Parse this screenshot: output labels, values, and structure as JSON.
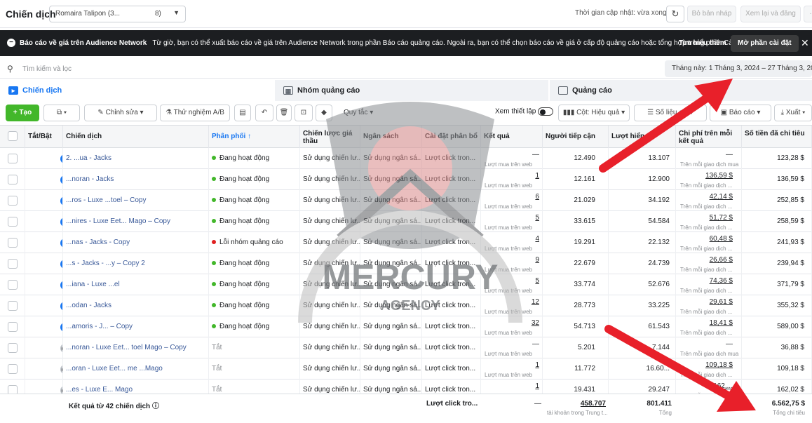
{
  "topbar": {
    "title": "Chiến dịch",
    "account_name": "Romaira Talipon (3...",
    "account_num": "8)",
    "update_text": "Thời gian cập nhật: vừa xong",
    "discard_label": "Bỏ bản nháp",
    "review_label": "Xem lại và đăng"
  },
  "banner": {
    "title": "Báo cáo về giá trên Audience Network",
    "text": "Từ giờ, bạn có thể xuất báo cáo về giá trên Audience Network trong phần Báo cáo quảng cáo. Ngoài ra, bạn có thể chọn báo cáo về giá ở cấp độ quảng cáo hoặc tổng hợp trong phần Cài...",
    "learn_more": "Tìm hiểu thêm",
    "open_settings": "Mở phần cài đặt"
  },
  "search": {
    "placeholder": "Tìm kiếm và lọc",
    "date_range": "Tháng này: 1 Tháng 3, 2024 – 27 Tháng 3, 2024"
  },
  "tabs": {
    "campaigns": "Chiến dịch",
    "adsets": "Nhóm quảng cáo",
    "ads": "Quảng cáo"
  },
  "toolbar": {
    "create": "+ Tạo",
    "edit": "Chỉnh sửa",
    "ab_test": "Thử nghiệm A/B",
    "rules": "Quy tắc",
    "view_setup": "Xem thiết lập",
    "columns": "Cột: Hiệu quả",
    "breakdown": "Số liệu chi",
    "reports": "Báo cáo",
    "export": "Xuất"
  },
  "columns": {
    "onoff": "Tắt/Bật",
    "campaign": "Chiến dịch",
    "delivery": "Phân phối ↑",
    "bid": "Chiến lược giá thầu",
    "budget": "Ngân sách",
    "attribution": "Cài đặt phân bổ",
    "results": "Kết quả",
    "reach": "Người tiếp cận",
    "impressions": "Lượt hiển",
    "cpr": "Chi phí trên mỗi kết quả",
    "spent": "Số tiền đã chi tiêu"
  },
  "rows": [
    {
      "on": true,
      "name": "2.  ...ua - Jacks",
      "status": "Đang hoạt động",
      "status_color": "#42b72a",
      "bid": "Sử dụng chiến lư...",
      "budget": "Sử dụng ngân sá...",
      "attr": "Lượt click tron...",
      "result": "—",
      "result_sub": "Lượt mua trên web",
      "reach": "12.490",
      "impr": "13.107",
      "cpr": "—",
      "cpr_sub": "Trên mỗi giao dịch mua",
      "spent": "123,28 $"
    },
    {
      "on": true,
      "name": "...noran - Jacks",
      "status": "Đang hoạt động",
      "status_color": "#42b72a",
      "bid": "Sử dụng chiến lư...",
      "budget": "Sử dụng ngân sá...",
      "attr": "Lượt click tron...",
      "result": "1",
      "result_sub": "Lượt mua trên web",
      "reach": "12.161",
      "impr": "12.900",
      "cpr": "136,59 $",
      "cpr_sub": "Trên mỗi giao dịch ...",
      "spent": "136,59 $"
    },
    {
      "on": true,
      "name": "...ros - Luxe ...toel – Copy",
      "status": "Đang hoạt động",
      "status_color": "#42b72a",
      "bid": "Sử dụng chiến lư...",
      "budget": "Sử dụng ngân sá...",
      "attr": "Lượt click tron...",
      "result": "6",
      "result_sub": "Lượt mua trên web",
      "reach": "21.029",
      "impr": "34.192",
      "cpr": "42,14 $",
      "cpr_sub": "Trên mỗi giao dịch ...",
      "spent": "252,85 $"
    },
    {
      "on": true,
      "name": "...nires - Luxe Eet... Mago – Copy",
      "status": "Đang hoạt động",
      "status_color": "#42b72a",
      "bid": "Sử dụng chiến lư...",
      "budget": "Sử dụng ngân sá...",
      "attr": "Lượt click tron...",
      "result": "5",
      "result_sub": "Lượt mua trên web",
      "reach": "33.615",
      "impr": "54.584",
      "cpr": "51,72 $",
      "cpr_sub": "Trên mỗi giao dịch ...",
      "spent": "258,59 $"
    },
    {
      "on": true,
      "name": "...nas - Jacks - Copy",
      "status": "Lỗi nhóm quảng cáo",
      "status_color": "#e02020",
      "bid": "Sử dụng chiến lư...",
      "budget": "Sử dụng ngân sá...",
      "attr": "Lượt click tron...",
      "result": "4",
      "result_sub": "Lượt mua trên web",
      "reach": "19.291",
      "impr": "22.132",
      "cpr": "60,48 $",
      "cpr_sub": "Trên mỗi giao dịch ...",
      "spent": "241,93 $"
    },
    {
      "on": true,
      "name": "...s - Jacks - ...y – Copy 2",
      "status": "Đang hoạt động",
      "status_color": "#42b72a",
      "bid": "Sử dụng chiến lư...",
      "budget": "Sử dụng ngân sá...",
      "attr": "Lượt click tron...",
      "result": "9",
      "result_sub": "Lượt mua trên web",
      "reach": "22.679",
      "impr": "24.739",
      "cpr": "26,66 $",
      "cpr_sub": "Trên mỗi giao dịch ...",
      "spent": "239,94 $"
    },
    {
      "on": true,
      "name": "...iana - Luxe ...el",
      "status": "Đang hoạt động",
      "status_color": "#42b72a",
      "bid": "Sử dụng chiến lư...",
      "budget": "Sử dụng ngân sá...",
      "attr": "Lượt click tron...",
      "result": "5",
      "result_sub": "Lượt mua trên web",
      "reach": "33.774",
      "impr": "52.676",
      "cpr": "74,36 $",
      "cpr_sub": "Trên mỗi giao dịch ...",
      "spent": "371,79 $"
    },
    {
      "on": true,
      "name": "...odan - Jacks",
      "status": "Đang hoạt động",
      "status_color": "#42b72a",
      "bid": "Sử dụng chiến lư...",
      "budget": "Sử dụng ngân sá...",
      "attr": "Lượt click tron...",
      "result": "12",
      "result_sub": "Lượt mua trên web",
      "reach": "28.773",
      "impr": "33.225",
      "cpr": "29,61 $",
      "cpr_sub": "Trên mỗi giao dịch ...",
      "spent": "355,32 $"
    },
    {
      "on": true,
      "name": "...amoris - J... – Copy",
      "status": "Đang hoạt động",
      "status_color": "#42b72a",
      "bid": "Sử dụng chiến lư...",
      "budget": "Sử dụng ngân sá...",
      "attr": "Lượt click tron...",
      "result": "32",
      "result_sub": "Lượt mua trên web",
      "reach": "54.713",
      "impr": "61.543",
      "cpr": "18,41 $",
      "cpr_sub": "Trên mỗi giao dịch ...",
      "spent": "589,00 $"
    },
    {
      "on": false,
      "name": "...noran - Luxe Eet... toel Mago – Copy",
      "status": "Tắt",
      "status_color": "",
      "bid": "Sử dụng chiến lư...",
      "budget": "Sử dụng ngân sá...",
      "attr": "Lượt click tron...",
      "result": "—",
      "result_sub": "Lượt mua trên web",
      "reach": "5.201",
      "impr": "7.144",
      "cpr": "—",
      "cpr_sub": "Trên mỗi giao dịch mua",
      "spent": "36,88 $"
    },
    {
      "on": false,
      "name": "...oran - Luxe Eet... me ...Mago",
      "status": "Tắt",
      "status_color": "",
      "bid": "Sử dụng chiến lư...",
      "budget": "Sử dụng ngân sá...",
      "attr": "Lượt click tron...",
      "result": "1",
      "result_sub": "Lượt mua trên web",
      "reach": "11.772",
      "impr": "16.60...",
      "cpr": "109,18 $",
      "cpr_sub": "Trên mỗi giao dịch ...",
      "spent": "109,18 $"
    },
    {
      "on": false,
      "name": "...es - Luxe E... Mago",
      "status": "Tắt",
      "status_color": "",
      "bid": "Sử dụng chiến lư...",
      "budget": "Sử dụng ngân sá...",
      "attr": "Lượt click tron...",
      "result": "1",
      "result_sub": "Lượt mua trên web",
      "reach": "19.431",
      "impr": "29.247",
      "cpr": "162,...",
      "cpr_sub": "Trên mỗi giao dịch ...",
      "spent": "162,02 $"
    }
  ],
  "totals": {
    "label": "Kết quả từ 42 chiến dịch",
    "attr": "Lượt click tro...",
    "result": "—",
    "reach": "458.707",
    "reach_sub": "tài khoản trong Trung t...",
    "impr": "801.411",
    "impr_sub": "Tổng",
    "spent": "6.562,75 $",
    "spent_sub": "Tổng chi tiêu"
  },
  "watermark": {
    "line1": "MERCURY",
    "line2": "AGENCY"
  },
  "colors": {
    "accent": "#1877f2",
    "create": "#42b72a",
    "arrow": "#e8202a",
    "banner": "#1c1e21"
  }
}
